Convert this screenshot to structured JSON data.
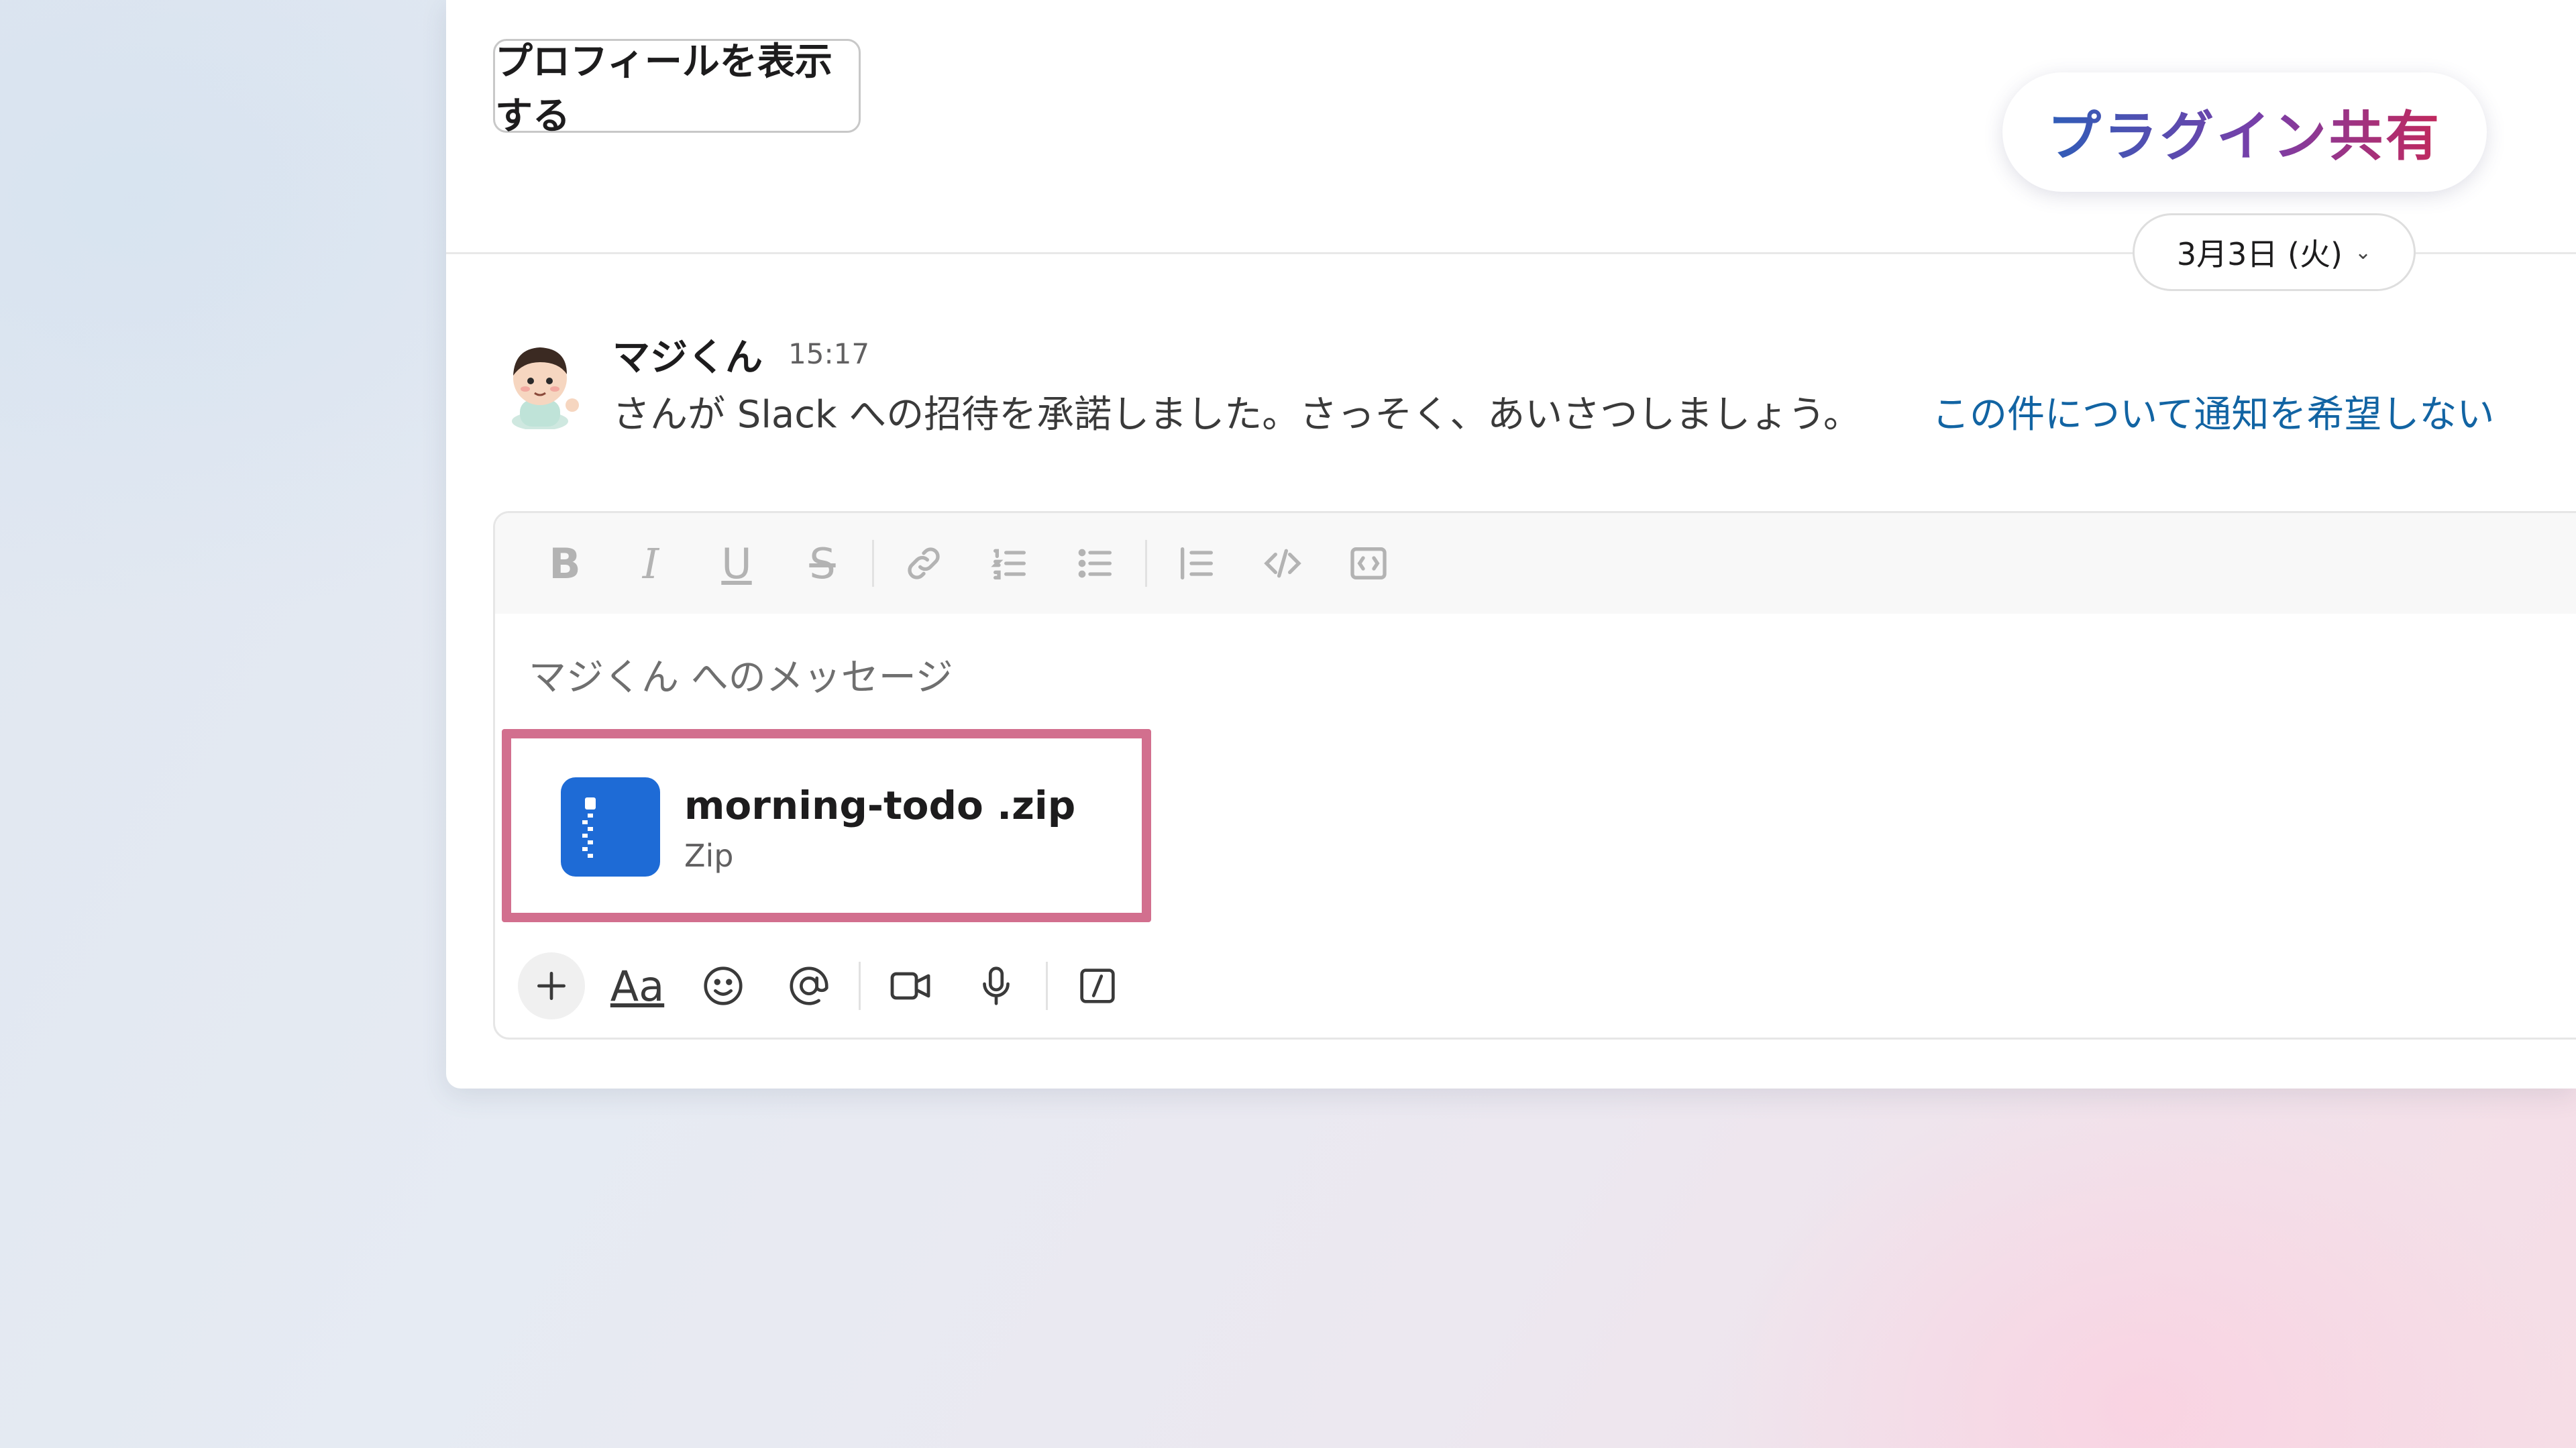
{
  "header": {
    "profile_button": "プロフィールを表示する",
    "plugin_badge": "プラグイン共有",
    "date_chip": "3月3日 (火)"
  },
  "message": {
    "author": "マジくん",
    "time": "15:17",
    "text": "さんが Slack への招待を承諾しました。さっそく、あいさつしましょう。",
    "link": "この件について通知を希望しない"
  },
  "composer": {
    "placeholder": "マジくん へのメッセージ",
    "attachment": {
      "file_name": "morning-todo .zip",
      "file_type": "Zip"
    },
    "format_toolbar": [
      "bold-icon",
      "italic-icon",
      "underline-icon",
      "strikethrough-icon",
      "link-icon",
      "ordered-list-icon",
      "bullet-list-icon",
      "blockquote-icon",
      "code-icon",
      "code-block-icon"
    ],
    "bottom_toolbar": [
      "plus-icon",
      "text-format-icon",
      "emoji-icon",
      "mention-icon",
      "video-icon",
      "microphone-icon",
      "slash-command-icon"
    ],
    "text_format_label": "Aa"
  },
  "colors": {
    "highlight_border": "#d26f8e",
    "link": "#1264a3",
    "zip_icon": "#1e6bd6",
    "plugin_gradient": [
      "#2f5db8",
      "#7a3ea8",
      "#c2285c"
    ]
  }
}
